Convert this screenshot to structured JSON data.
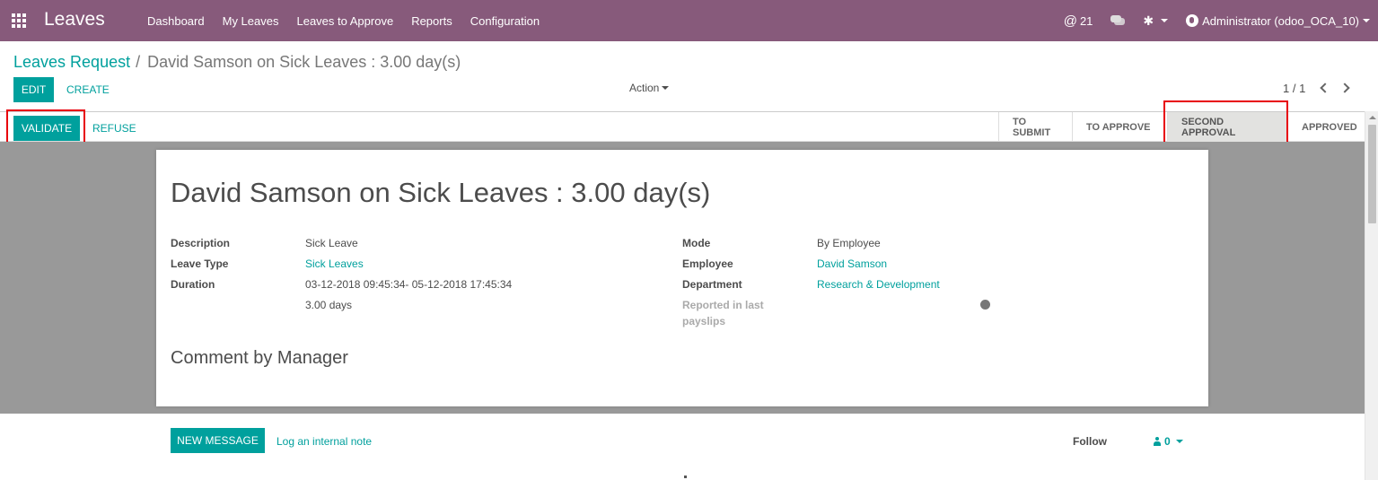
{
  "navbar": {
    "brand": "Leaves",
    "menu": [
      "Dashboard",
      "My Leaves",
      "Leaves to Approve",
      "Reports",
      "Configuration"
    ],
    "mention_count": "21",
    "user": "Administrator (odoo_OCA_10)"
  },
  "control_panel": {
    "breadcrumb_parent": "Leaves Request",
    "breadcrumb_separator": "/",
    "breadcrumb_current": "David Samson on Sick Leaves : 3.00 day(s)",
    "edit_label": "EDIT",
    "create_label": "CREATE",
    "action_label": "Action",
    "pager": "1 / 1"
  },
  "statusbar": {
    "validate_label": "VALIDATE",
    "refuse_label": "REFUSE",
    "stages": [
      "TO SUBMIT",
      "TO APPROVE",
      "SECOND APPROVAL",
      "APPROVED"
    ],
    "active_stage": "SECOND APPROVAL"
  },
  "form": {
    "title": "David Samson on Sick Leaves : 3.00 day(s)",
    "left": {
      "description_label": "Description",
      "description_value": "Sick Leave",
      "leave_type_label": "Leave Type",
      "leave_type_value": "Sick Leaves",
      "duration_label": "Duration",
      "duration_value": "03-12-2018 09:45:34- 05-12-2018 17:45:34",
      "days_value": "3.00 days"
    },
    "right": {
      "mode_label": "Mode",
      "mode_value": "By Employee",
      "employee_label": "Employee",
      "employee_value": "David Samson",
      "department_label": "Department",
      "department_value": "Research & Development",
      "reported_label_line1": "Reported in last",
      "reported_label_line2": "payslips"
    },
    "comment_title": "Comment by Manager"
  },
  "chatter": {
    "new_message_label": "NEW MESSAGE",
    "internal_note_label": "Log an internal note",
    "follow_label": "Follow",
    "followers_count": "0"
  },
  "colors": {
    "navbar": "#875a7b",
    "primary": "#00a09d",
    "highlight": "#e8000b"
  }
}
